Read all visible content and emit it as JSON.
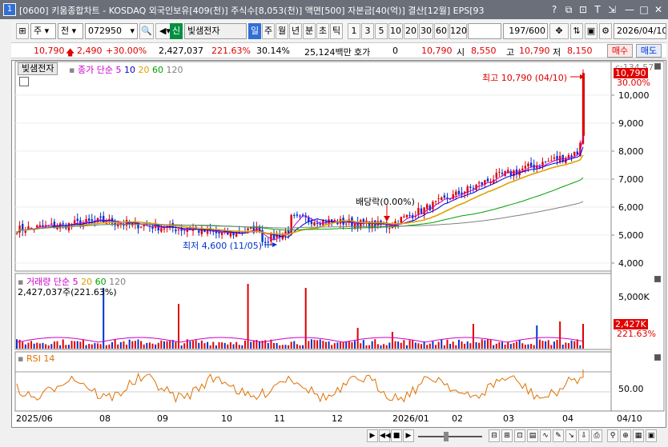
{
  "window": {
    "number": "1",
    "title": "[0600] 키움종합차트 - KOSDAQ 외국인보유[409(천)] 주식수[8,053(천)] 액면[500] 자본금[40(억)] 결산[12월] EPS[93"
  },
  "toolbar": {
    "type_label": "주",
    "mode_label": "전",
    "code": "072950",
    "market_badge": "신",
    "stock_name": "빛샘전자",
    "periods": [
      "일",
      "주",
      "월",
      "년",
      "분",
      "초",
      "틱"
    ],
    "intervals": [
      "1",
      "3",
      "5",
      "10",
      "20",
      "30",
      "60",
      "120"
    ],
    "count": "197",
    "count_total": "/600",
    "date": "2026/04/10"
  },
  "quote": {
    "price": "10,790",
    "change": "2,490",
    "change_pct": "+30.00%",
    "volume": "2,427,037",
    "volume_ratio": "221.63%",
    "turnover": "30.14%",
    "amount": "25,124백만",
    "hoga_label": "호가",
    "hoga_value": "0",
    "ask": "10,790",
    "open_label": "시",
    "open": "8,550",
    "high_label": "고",
    "high": "10,790",
    "low_label": "저",
    "low": "8,150",
    "buy_label": "매수",
    "sell_label": "매도"
  },
  "price_panel": {
    "stock_tab": "빛샘전자",
    "legend": [
      {
        "text": "종가",
        "color": "#cc00cc"
      },
      {
        "text": "단순",
        "color": "#cc00cc"
      },
      {
        "text": "5",
        "color": "#cc00cc"
      },
      {
        "text": "10",
        "color": "#0000cc"
      },
      {
        "text": "20",
        "color": "#e0a000"
      },
      {
        "text": "60",
        "color": "#00a000"
      },
      {
        "text": "120",
        "color": "#808080"
      }
    ],
    "high_annotation": "최고 10,790 (04/10)",
    "low_annotation": "최저 4,600 (11/05)",
    "dividend_annotation": "배당락(0.00%)",
    "last_price_label": "10,790",
    "last_pct_label": "30.00%",
    "top_label": "c:134.57",
    "y_ticks": [
      "10,000",
      "9,000",
      "8,000",
      "7,000",
      "6,000",
      "5,000",
      "4,000"
    ]
  },
  "volume_panel": {
    "legend": [
      {
        "text": "거래량",
        "color": "#cc00cc"
      },
      {
        "text": "단순",
        "color": "#cc00cc"
      },
      {
        "text": "5",
        "color": "#cc00cc"
      },
      {
        "text": "20",
        "color": "#e0a000"
      },
      {
        "text": "60",
        "color": "#00a000"
      },
      {
        "text": "120",
        "color": "#808080"
      }
    ],
    "current": "2,427,037주(221.63%)",
    "y_ticks": [
      "5,000K"
    ],
    "last_label": "2,427K",
    "last_pct": "221.63%"
  },
  "rsi_panel": {
    "legend": "RSI 14",
    "y_ticks": [
      "50.00"
    ]
  },
  "x_axis": {
    "labels": [
      "2025/06",
      "08",
      "09",
      "10",
      "11",
      "12",
      "2026/01",
      "02",
      "03",
      "04"
    ],
    "right_label": "04/10"
  },
  "colors": {
    "up": "#e00000",
    "down": "#0033cc",
    "ma5": "#cc00cc",
    "ma10": "#0000cc",
    "ma20": "#e0a000",
    "ma60": "#00a000",
    "ma120": "#808080",
    "rsi": "#e07000"
  },
  "chart_data": {
    "type": "candlestick",
    "title": "빛샘전자",
    "ylim": [
      4000,
      10790
    ],
    "key_points": [
      {
        "date": "11/05",
        "value": 4600,
        "label": "최저"
      },
      {
        "date": "04/10",
        "value": 10790,
        "label": "최고"
      }
    ],
    "last": {
      "date": "04/10",
      "close": 10790,
      "open": 8550,
      "high": 10790,
      "low": 8150,
      "volume": 2427037
    }
  }
}
